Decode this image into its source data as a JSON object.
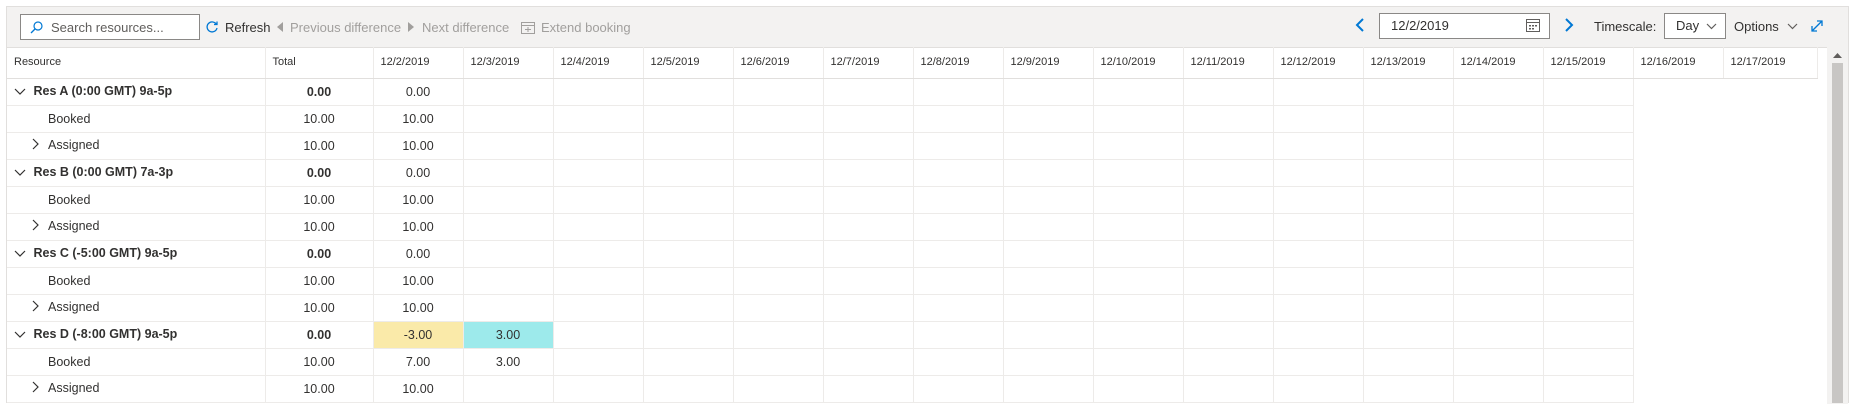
{
  "toolbar": {
    "search_placeholder": "Search resources...",
    "refresh_label": "Refresh",
    "previous_difference_label": "Previous difference",
    "next_difference_label": "Next difference",
    "extend_booking_label": "Extend booking",
    "date_value": "12/2/2019",
    "timescale_label": "Timescale:",
    "timescale_value": "Day",
    "options_label": "Options"
  },
  "grid": {
    "headers": {
      "resource": "Resource",
      "total": "Total",
      "dates": [
        "12/2/2019",
        "12/3/2019",
        "12/4/2019",
        "12/5/2019",
        "12/6/2019",
        "12/7/2019",
        "12/8/2019",
        "12/9/2019",
        "12/10/2019",
        "12/11/2019",
        "12/12/2019",
        "12/13/2019",
        "12/14/2019",
        "12/15/2019",
        "12/16/2019",
        "12/17/2019"
      ]
    },
    "rows": [
      {
        "label": "Res A (0:00 GMT) 9a-5p",
        "total": "0.00",
        "d1": "0.00",
        "d2": ""
      },
      {
        "label": "Booked",
        "total": "10.00",
        "d1": "10.00",
        "d2": ""
      },
      {
        "label": "Assigned",
        "total": "10.00",
        "d1": "10.00",
        "d2": ""
      },
      {
        "label": "Res B (0:00 GMT) 7a-3p",
        "total": "0.00",
        "d1": "0.00",
        "d2": ""
      },
      {
        "label": "Booked",
        "total": "10.00",
        "d1": "10.00",
        "d2": ""
      },
      {
        "label": "Assigned",
        "total": "10.00",
        "d1": "10.00",
        "d2": ""
      },
      {
        "label": "Res C (-5:00 GMT) 9a-5p",
        "total": "0.00",
        "d1": "0.00",
        "d2": ""
      },
      {
        "label": "Booked",
        "total": "10.00",
        "d1": "10.00",
        "d2": ""
      },
      {
        "label": "Assigned",
        "total": "10.00",
        "d1": "10.00",
        "d2": ""
      },
      {
        "label": "Res D (-8:00 GMT) 9a-5p",
        "total": "0.00",
        "d1": "-3.00",
        "d2": "3.00"
      },
      {
        "label": "Booked",
        "total": "10.00",
        "d1": "7.00",
        "d2": "3.00"
      },
      {
        "label": "Assigned",
        "total": "10.00",
        "d1": "10.00",
        "d2": ""
      }
    ]
  },
  "colors": {
    "negative_difference": "#faeaa9",
    "positive_difference": "#9deaeb",
    "accent": "#0078d4"
  }
}
